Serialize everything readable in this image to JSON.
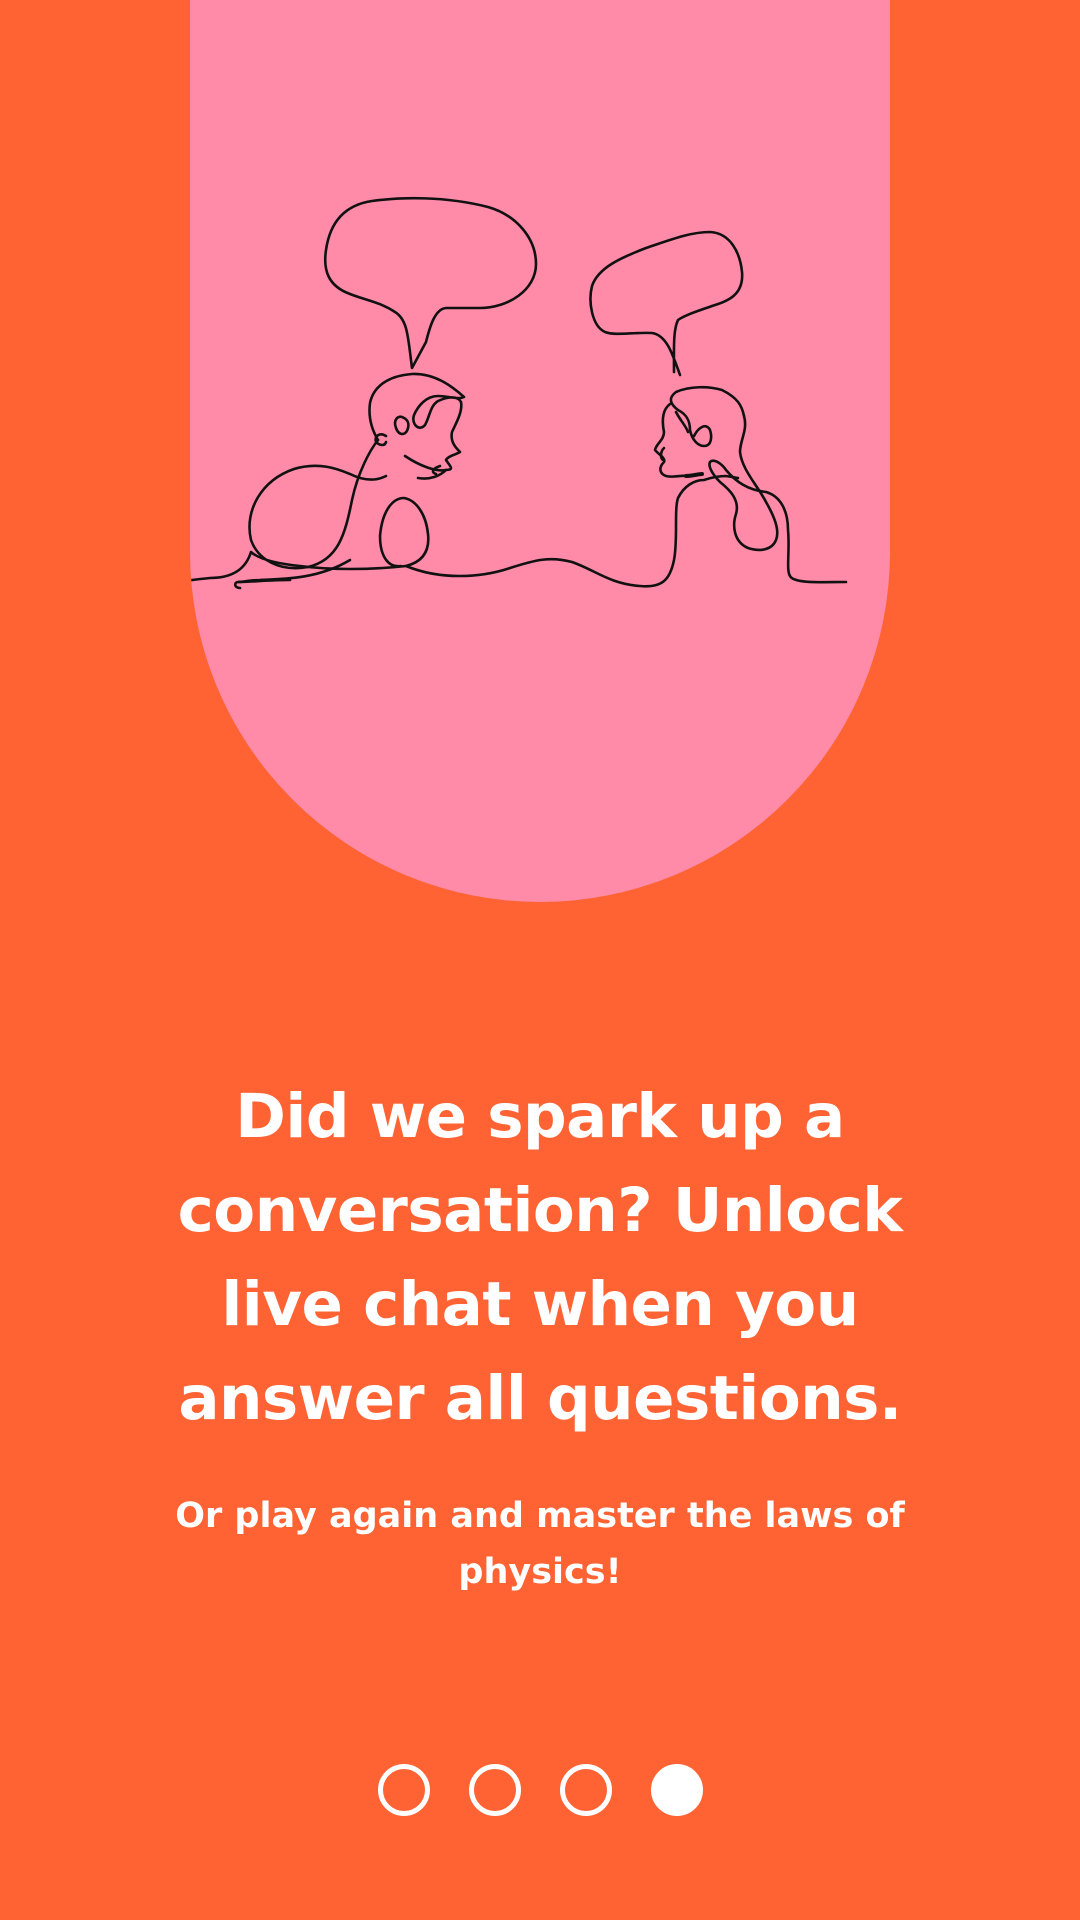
{
  "colors": {
    "background": "#FF6333",
    "card": "#FF8BA9",
    "text": "#FFFFFF",
    "line_art": "#111111"
  },
  "illustration": {
    "icon": "two-people-conversation-line-art-icon"
  },
  "headline": "Did we spark up a conversation? Unlock live chat when you answer all questions.",
  "subtext": "Or play again and master the laws of physics!",
  "pagination": {
    "total": 4,
    "active_index": 3
  }
}
